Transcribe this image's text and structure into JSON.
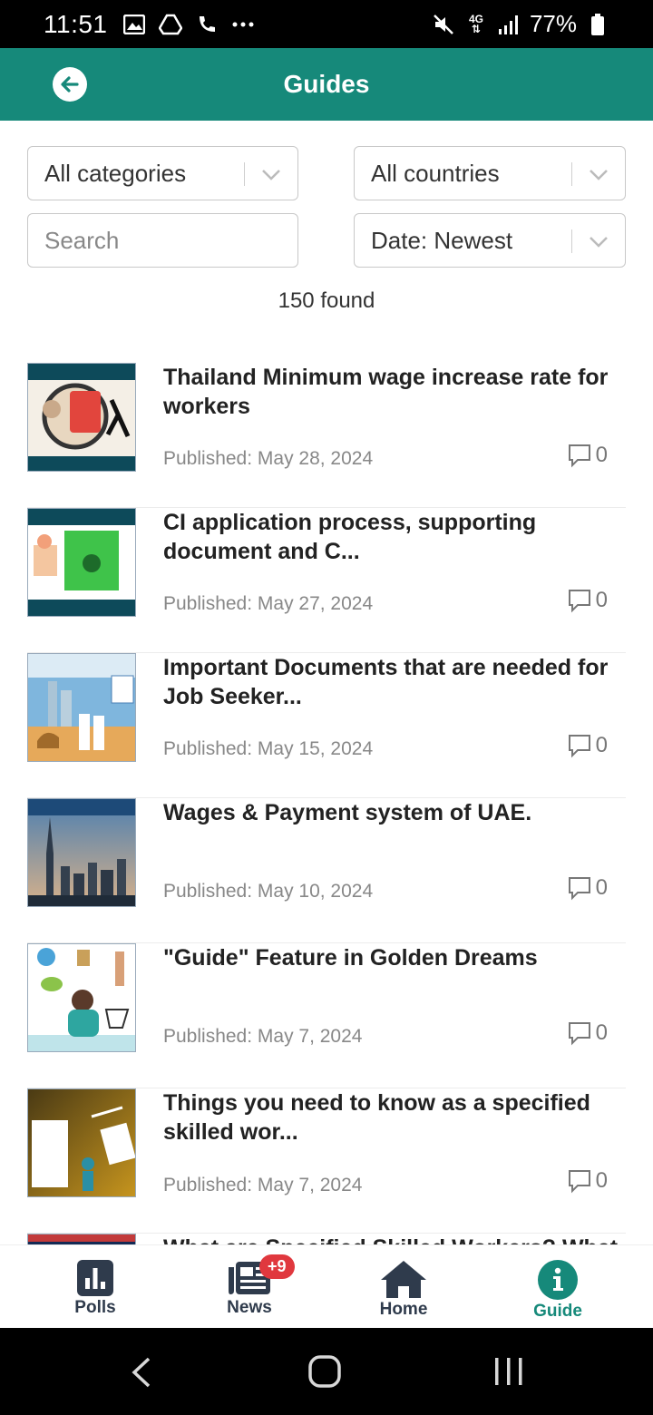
{
  "status_bar": {
    "time": "11:51",
    "battery": "77%",
    "network": "4G"
  },
  "app_bar": {
    "title": "Guides"
  },
  "filters": {
    "category": "All categories",
    "country": "All countries",
    "search_placeholder": "Search",
    "sort": "Date: Newest"
  },
  "results_count": "150 found",
  "guides": [
    {
      "title": "Thailand Minimum wage increase rate for workers",
      "published": "Published: May 28, 2024",
      "comments": "0"
    },
    {
      "title": "CI application process, supporting document and C...",
      "published": "Published: May 27, 2024",
      "comments": "0"
    },
    {
      "title": "Important Documents that are needed for Job Seeker...",
      "published": "Published: May 15, 2024",
      "comments": "0"
    },
    {
      "title": "Wages & Payment system of UAE.",
      "published": "Published: May 10, 2024",
      "comments": "0"
    },
    {
      "title": "\"Guide\" Feature in Golden Dreams",
      "published": "Published: May 7, 2024",
      "comments": "0"
    },
    {
      "title": "Things you need to know as a specified skilled wor...",
      "published": "Published: May 7, 2024",
      "comments": "0"
    },
    {
      "title": "What are Specified Skilled Workers? What",
      "published": "",
      "comments": ""
    }
  ],
  "bottom_nav": {
    "polls": "Polls",
    "news": "News",
    "news_badge": "+9",
    "home": "Home",
    "guide": "Guide"
  },
  "colors": {
    "primary": "#16897a",
    "badge": "#e0383e",
    "nav_text": "#2f3b4c"
  }
}
